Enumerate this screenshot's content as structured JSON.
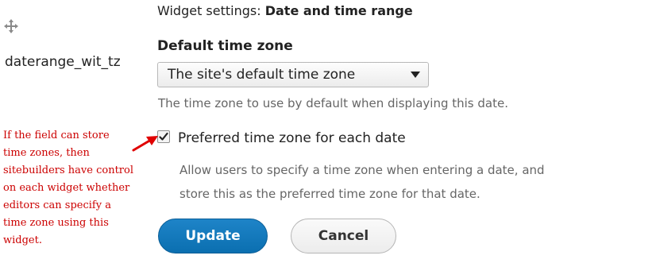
{
  "widget_settings": {
    "title_prefix": "Widget settings:",
    "title_value": "Date and time range"
  },
  "field": {
    "name": "daterange_wit_tz",
    "drag_icon": "move-icon"
  },
  "default_timezone": {
    "label": "Default time zone",
    "selected": "The site's default time zone",
    "description": "The time zone to use by default when displaying this date."
  },
  "preferred_timezone": {
    "checked": true,
    "label": "Preferred time zone for each date",
    "description_line1": "Allow users to specify a time zone when entering a date, and",
    "description_line2": "store this as the preferred time zone for that date."
  },
  "buttons": {
    "update_label": "Update",
    "cancel_label": "Cancel"
  },
  "annotation": {
    "lines": [
      "If the field can store",
      "time zones, then",
      "sitebuilders have control",
      "on each widget whether",
      "editors can specify a",
      "time zone using this",
      "widget."
    ],
    "color": "#cc0000"
  },
  "colors": {
    "primary_button": "#0b6fb0",
    "description_text": "#666666",
    "annotation": "#cc0000"
  }
}
